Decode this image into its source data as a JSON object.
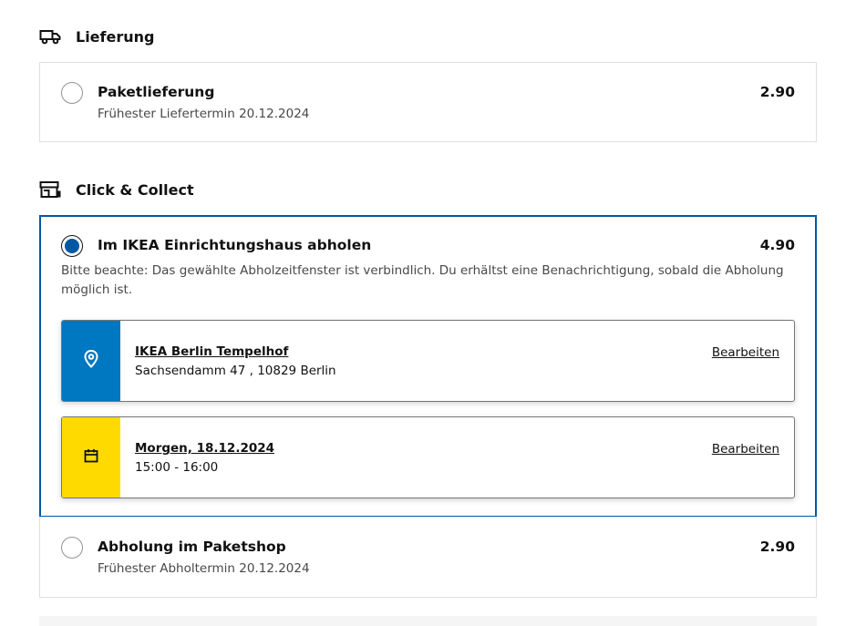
{
  "delivery": {
    "header": "Lieferung",
    "header_icon": "truck-icon",
    "options": [
      {
        "title": "Paketlieferung",
        "subtitle": "Frühester Liefertermin 20.12.2024",
        "price": "2.90",
        "selected": false
      }
    ]
  },
  "click_collect": {
    "header": "Click & Collect",
    "header_icon": "store-icon",
    "store_pickup": {
      "title": "Im IKEA Einrichtungshaus abholen",
      "price": "4.90",
      "selected": true,
      "note": "Bitte beachte: Das gewählte Abholzeitfenster ist verbindlich. Du erhältst eine Benachrichtigung, sobald die Abholung möglich ist.",
      "location": {
        "icon": "location-pin-icon",
        "name": "IKEA Berlin Tempelhof",
        "address": "Sachsendamm 47 , 10829 Berlin",
        "edit_label": "Bearbeiten",
        "color": "#0077c1"
      },
      "timeslot": {
        "icon": "calendar-icon",
        "date": "Morgen, 18.12.2024",
        "time": "15:00 - 16:00",
        "edit_label": "Bearbeiten",
        "color": "#ffda00"
      }
    },
    "parcel_shop": {
      "title": "Abholung im Paketshop",
      "subtitle": "Frühester Abholtermin 20.12.2024",
      "price": "2.90",
      "selected": false
    }
  },
  "colors": {
    "accent": "#0058a3",
    "border": "#dfdfdf",
    "text": "#111111",
    "muted": "#484848"
  }
}
